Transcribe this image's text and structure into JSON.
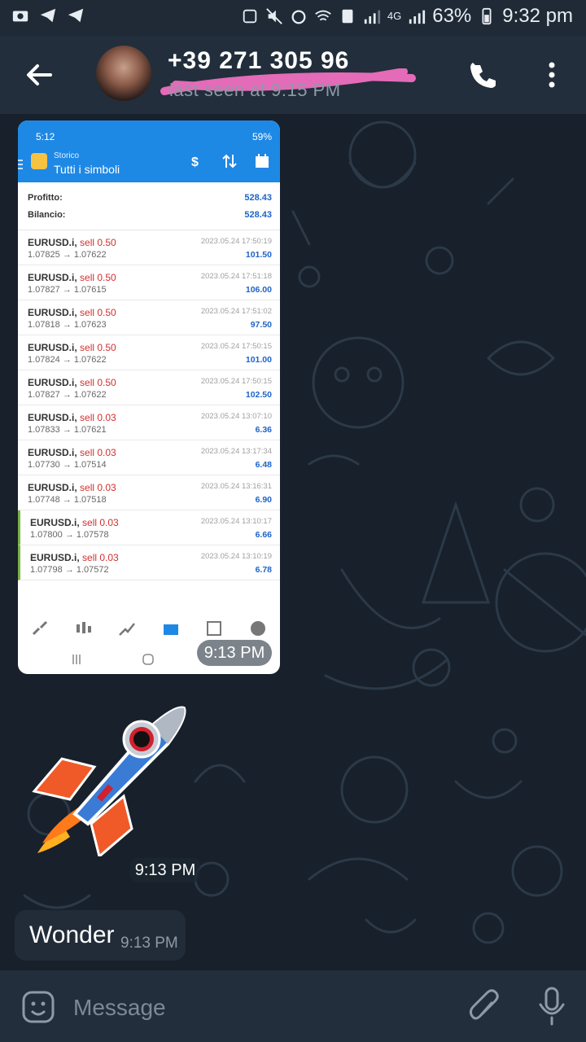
{
  "status_bar": {
    "network": "4G",
    "battery": "63%",
    "time": "9:32 pm"
  },
  "header": {
    "title": "+39 271 305 96",
    "subtitle": "last seen at 9:15 PM"
  },
  "shared_screenshot": {
    "status_time": "5:12",
    "status_battery": "59%",
    "app_subtitle": "Storico",
    "app_title": "Tutti i simboli",
    "summary": [
      {
        "label": "Profitto:",
        "value": "528.43"
      },
      {
        "label": "Bilancio:",
        "value": "528.43"
      }
    ],
    "deals": [
      {
        "symbol": "EURUSD.i,",
        "side": "sell 0.50",
        "prices": "1.07825 → 1.07622",
        "date": "2023.05.24 17:50:19",
        "profit": "101.50"
      },
      {
        "symbol": "EURUSD.i,",
        "side": "sell 0.50",
        "prices": "1.07827 → 1.07615",
        "date": "2023.05.24 17:51:18",
        "profit": "106.00"
      },
      {
        "symbol": "EURUSD.i,",
        "side": "sell 0.50",
        "prices": "1.07818 → 1.07623",
        "date": "2023.05.24 17:51:02",
        "profit": "97.50"
      },
      {
        "symbol": "EURUSD.i,",
        "side": "sell 0.50",
        "prices": "1.07824 → 1.07622",
        "date": "2023.05.24 17:50:15",
        "profit": "101.00"
      },
      {
        "symbol": "EURUSD.i,",
        "side": "sell 0.50",
        "prices": "1.07827 → 1.07622",
        "date": "2023.05.24 17:50:15",
        "profit": "102.50"
      },
      {
        "symbol": "EURUSD.i,",
        "side": "sell 0.03",
        "prices": "1.07833 → 1.07621",
        "date": "2023.05.24 13:07:10",
        "profit": "6.36"
      },
      {
        "symbol": "EURUSD.i,",
        "side": "sell 0.03",
        "prices": "1.07730 → 1.07514",
        "date": "2023.05.24 13:17:34",
        "profit": "6.48"
      },
      {
        "symbol": "EURUSD.i,",
        "side": "sell 0.03",
        "prices": "1.07748 → 1.07518",
        "date": "2023.05.24 13:16:31",
        "profit": "6.90"
      },
      {
        "symbol": "EURUSD.i,",
        "side": "sell 0.03",
        "prices": "1.07800 → 1.07578",
        "date": "2023.05.24 13:10:17",
        "profit": "6.66"
      },
      {
        "symbol": "EURUSD.i,",
        "side": "sell 0.03",
        "prices": "1.07798 → 1.07572",
        "date": "2023.05.24 13:10:19",
        "profit": "6.78"
      }
    ],
    "time": "9:13 PM"
  },
  "sticker": {
    "icon": "rocket-sticker",
    "time": "9:13 PM"
  },
  "message": {
    "text": "Wonder",
    "time": "9:13 PM"
  },
  "composer": {
    "placeholder": "Message"
  },
  "colors": {
    "header": "#222e3b",
    "background": "#17202b",
    "mt_blue": "#1e88e5",
    "sell_red": "#d32f2f",
    "profit_blue": "#1e64c8"
  }
}
